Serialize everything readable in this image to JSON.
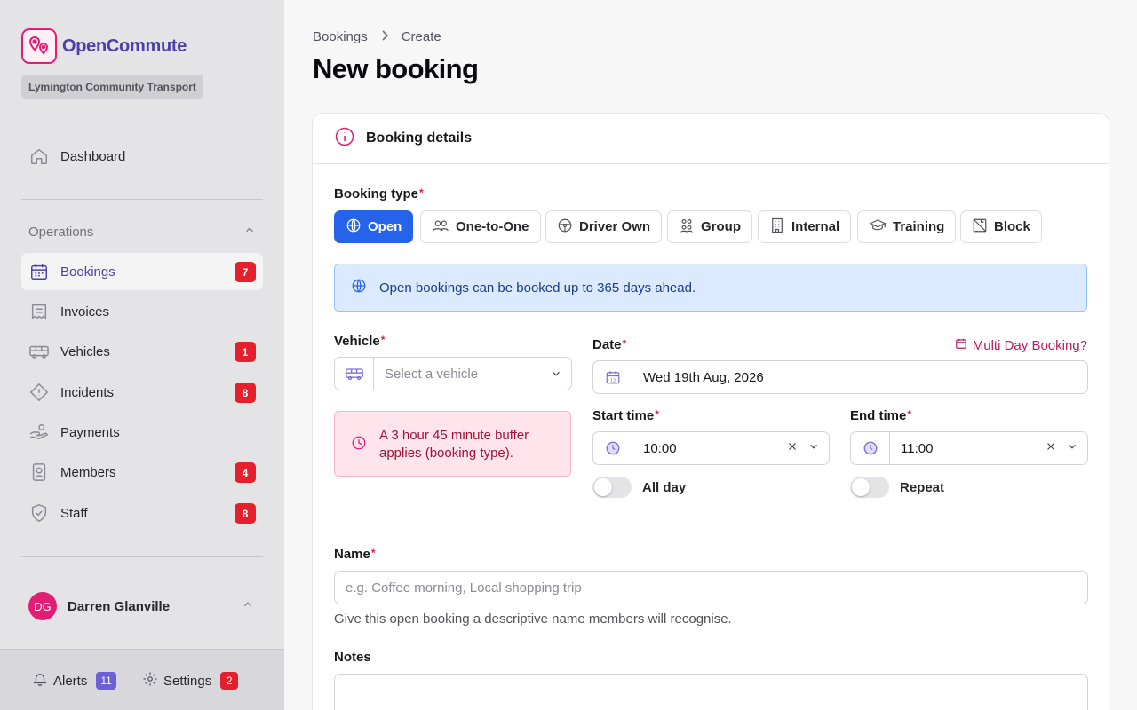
{
  "brand": {
    "name": "OpenCommute",
    "org": "Lymington Community Transport",
    "color": "#e11d74",
    "accent": "#4c3fa8"
  },
  "sidebar": {
    "dashboard": {
      "label": "Dashboard",
      "icon": "home-icon"
    },
    "section": "Operations",
    "items": [
      {
        "label": "Bookings",
        "icon": "calendar-icon",
        "badge": "7",
        "active": true
      },
      {
        "label": "Invoices",
        "icon": "invoice-icon",
        "badge": ""
      },
      {
        "label": "Vehicles",
        "icon": "bus-icon",
        "badge": "1"
      },
      {
        "label": "Incidents",
        "icon": "warning-icon",
        "badge": "8"
      },
      {
        "label": "Payments",
        "icon": "hand-coins-icon",
        "badge": ""
      },
      {
        "label": "Members",
        "icon": "id-badge-icon",
        "badge": "4"
      },
      {
        "label": "Staff",
        "icon": "shield-icon",
        "badge": "8"
      }
    ],
    "user": {
      "initials": "DG",
      "name": "Darren Glanville"
    },
    "footer": {
      "alerts": {
        "label": "Alerts",
        "count": "11",
        "color": "#6d5fd6"
      },
      "settings": {
        "label": "Settings",
        "count": "2",
        "color": "#e5202d"
      }
    }
  },
  "breadcrumb": {
    "parent": "Bookings",
    "current": "Create"
  },
  "page": {
    "title": "New booking"
  },
  "card": {
    "title": "Booking details",
    "booking_type": {
      "label": "Booking type",
      "options": [
        {
          "label": "Open",
          "icon": "globe-icon",
          "selected": true
        },
        {
          "label": "One-to-One",
          "icon": "users-icon"
        },
        {
          "label": "Driver Own",
          "icon": "steering-wheel-icon"
        },
        {
          "label": "Group",
          "icon": "group-icon"
        },
        {
          "label": "Internal",
          "icon": "building-icon"
        },
        {
          "label": "Training",
          "icon": "graduation-cap-icon"
        },
        {
          "label": "Block",
          "icon": "block-icon"
        }
      ],
      "selected_color": "#2563eb"
    },
    "info": "Open bookings can be booked up to 365 days ahead.",
    "vehicle": {
      "label": "Vehicle",
      "placeholder": "Select a vehicle"
    },
    "buffer_notice": "A 3 hour 45 minute buffer applies (booking type).",
    "date": {
      "label": "Date",
      "value": "Wed 19th Aug, 2026",
      "multi_day": "Multi Day Booking?"
    },
    "start_time": {
      "label": "Start time",
      "value": "10:00"
    },
    "end_time": {
      "label": "End time",
      "value": "11:00"
    },
    "all_day": "All day",
    "repeat": "Repeat",
    "name": {
      "label": "Name",
      "placeholder": "e.g. Coffee morning, Local shopping trip",
      "hint": "Give this open booking a descriptive name members will recognise."
    },
    "notes": {
      "label": "Notes"
    }
  }
}
